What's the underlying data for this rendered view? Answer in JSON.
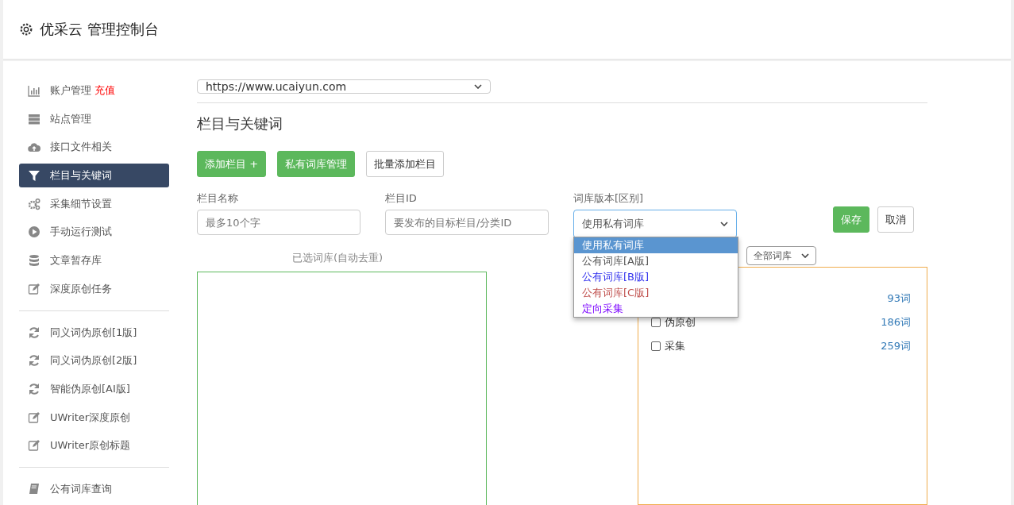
{
  "header": {
    "title": "优采云 管理控制台"
  },
  "sidebar": {
    "groups": [
      {
        "items": [
          {
            "label": "账户管理",
            "badge": "充值",
            "selected": false
          },
          {
            "label": "站点管理",
            "selected": false
          },
          {
            "label": "接口文件相关",
            "selected": false
          },
          {
            "label": "栏目与关键词",
            "selected": true
          },
          {
            "label": "采集细节设置",
            "selected": false
          },
          {
            "label": "手动运行测试",
            "selected": false
          },
          {
            "label": "文章暂存库",
            "selected": false
          },
          {
            "label": "深度原创任务",
            "selected": false
          }
        ]
      },
      {
        "items": [
          {
            "label": "同义词伪原创[1版]",
            "selected": false
          },
          {
            "label": "同义词伪原创[2版]",
            "selected": false
          },
          {
            "label": "智能伪原创[AI版]",
            "selected": false
          },
          {
            "label": "UWriter深度原创",
            "selected": false
          },
          {
            "label": "UWriter原创标题",
            "selected": false
          }
        ]
      },
      {
        "items": [
          {
            "label": "公有词库查询",
            "selected": false
          }
        ]
      }
    ]
  },
  "site_select": {
    "value": "https://www.ucaiyun.com"
  },
  "section_title": "栏目与关键词",
  "buttons": [
    {
      "label": "添加栏目 +",
      "kind": "green"
    },
    {
      "label": "私有词库管理",
      "kind": "green"
    },
    {
      "label": "批量添加栏目",
      "kind": "plain"
    }
  ],
  "form": {
    "fields": [
      {
        "label": "栏目名称",
        "placeholder": "最多10个字",
        "kind": "input"
      },
      {
        "label": "栏目ID",
        "placeholder": "要发布的目标栏目/分类ID",
        "kind": "input"
      },
      {
        "label": "词库版本[区别]",
        "value": "使用私有词库",
        "kind": "select",
        "expanded": true,
        "options": [
          {
            "label": "使用私有词库",
            "selected": true
          },
          {
            "label": "公有词库[A版]",
            "selected": false
          },
          {
            "label": "公有词库[B版]",
            "selected": false,
            "color": "#3333ee"
          },
          {
            "label": "公有词库[C版]",
            "selected": false,
            "color": "#c0504d"
          },
          {
            "label": "定向采集",
            "selected": false,
            "color": "#7a00ff"
          }
        ]
      }
    ],
    "save": "保存",
    "cancel": "取消"
  },
  "selected_panel": {
    "title": "已选词库(自动去重)"
  },
  "library_panel": {
    "filter": "全部词库",
    "items": [
      {
        "count": "93词"
      },
      {
        "label": "伪原创",
        "count": "186词",
        "checked": false
      },
      {
        "label": "采集",
        "count": "259词",
        "checked": false
      }
    ]
  }
}
